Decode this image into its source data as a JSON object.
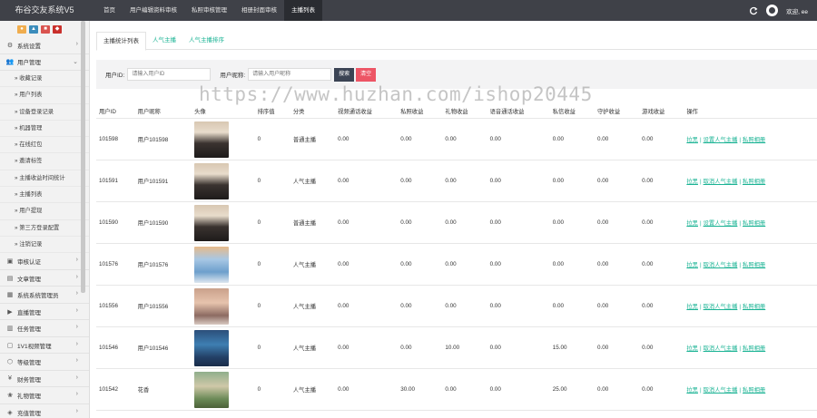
{
  "brand": "布谷交友系统V5",
  "topnav": [
    "首页",
    "用户编辑资料审核",
    "私照审核管理",
    "相册封面审核",
    "主播列表"
  ],
  "topnav_active": 4,
  "welcome": "欢迎, ee",
  "sidebar": {
    "quick_buttons": [
      "●",
      "▲",
      "■",
      "◆"
    ],
    "items": [
      {
        "type": "menu",
        "icon": "⚙",
        "label": "系统设置"
      },
      {
        "type": "menu",
        "icon": "👥",
        "label": "用户管理",
        "expanded": true
      },
      {
        "type": "sub",
        "label": "» 收藏记录"
      },
      {
        "type": "sub",
        "label": "» 用户列表"
      },
      {
        "type": "sub",
        "label": "» 设备登录记录"
      },
      {
        "type": "sub",
        "label": "» 机器管理"
      },
      {
        "type": "sub",
        "label": "» 在线红包"
      },
      {
        "type": "sub",
        "label": "» 邀请标签"
      },
      {
        "type": "sub",
        "label": "» 主播收益时间统计"
      },
      {
        "type": "sub",
        "label": "» 主播列表"
      },
      {
        "type": "sub",
        "label": "» 用户提现"
      },
      {
        "type": "sub",
        "label": "» 第三方登录配置"
      },
      {
        "type": "sub",
        "label": "» 注销记录"
      },
      {
        "type": "menu",
        "icon": "▣",
        "label": "审核认证"
      },
      {
        "type": "menu",
        "icon": "▤",
        "label": "文章管理"
      },
      {
        "type": "menu",
        "icon": "▦",
        "label": "系统系统管理员"
      },
      {
        "type": "menu",
        "icon": "▶",
        "label": "直播管理"
      },
      {
        "type": "menu",
        "icon": "▥",
        "label": "任务管理"
      },
      {
        "type": "menu",
        "icon": "▢",
        "label": "1V1视频管理"
      },
      {
        "type": "menu",
        "icon": "⬡",
        "label": "等级管理"
      },
      {
        "type": "menu",
        "icon": "¥",
        "label": "财务管理"
      },
      {
        "type": "menu",
        "icon": "❀",
        "label": "礼物管理"
      },
      {
        "type": "menu",
        "icon": "◈",
        "label": "充值管理"
      }
    ]
  },
  "tabs": [
    "主播统计列表",
    "人气主播",
    "人气主播排序"
  ],
  "search": {
    "uid_label": "用户ID:",
    "uid_placeholder": "请输入用户ID",
    "nick_label": "用户昵称:",
    "nick_placeholder": "请输入用户昵称",
    "search_btn": "搜索",
    "clear_btn": "清空"
  },
  "columns": [
    "用户ID",
    "用户昵称",
    "头像",
    "排序值",
    "分类",
    "视频通话收益",
    "私照收益",
    "礼物收益",
    "语音通话收益",
    "私信收益",
    "守护收益",
    "游戏收益",
    "操作"
  ],
  "rows": [
    {
      "uid": "101598",
      "nick": "用户101598",
      "photo": "ph-a",
      "sort": "0",
      "cat": "普通主播",
      "v": [
        "0.00",
        "0.00",
        "0.00",
        "0.00",
        "0.00",
        "0.00",
        "0.00"
      ],
      "ops": [
        "拉黑",
        "设置人气主播",
        "私照相册"
      ]
    },
    {
      "uid": "101591",
      "nick": "用户101591",
      "photo": "ph-a",
      "sort": "0",
      "cat": "人气主播",
      "v": [
        "0.00",
        "0.00",
        "0.00",
        "0.00",
        "0.00",
        "0.00",
        "0.00"
      ],
      "ops": [
        "拉黑",
        "取消人气主播",
        "私照相册"
      ]
    },
    {
      "uid": "101590",
      "nick": "用户101590",
      "photo": "ph-a",
      "sort": "0",
      "cat": "普通主播",
      "v": [
        "0.00",
        "0.00",
        "0.00",
        "0.00",
        "0.00",
        "0.00",
        "0.00"
      ],
      "ops": [
        "拉黑",
        "设置人气主播",
        "私照相册"
      ]
    },
    {
      "uid": "101576",
      "nick": "用户101576",
      "photo": "ph-b",
      "sort": "0",
      "cat": "人气主播",
      "v": [
        "0.00",
        "0.00",
        "0.00",
        "0.00",
        "0.00",
        "0.00",
        "0.00"
      ],
      "ops": [
        "拉黑",
        "取消人气主播",
        "私照相册"
      ]
    },
    {
      "uid": "101556",
      "nick": "用户101556",
      "photo": "ph-c",
      "sort": "0",
      "cat": "人气主播",
      "v": [
        "0.00",
        "0.00",
        "0.00",
        "0.00",
        "0.00",
        "0.00",
        "0.00"
      ],
      "ops": [
        "拉黑",
        "取消人气主播",
        "私照相册"
      ]
    },
    {
      "uid": "101546",
      "nick": "用户101546",
      "photo": "ph-d",
      "sort": "0",
      "cat": "人气主播",
      "v": [
        "0.00",
        "0.00",
        "10.00",
        "0.00",
        "15.00",
        "0.00",
        "0.00"
      ],
      "ops": [
        "拉黑",
        "取消人气主播",
        "私照相册"
      ]
    },
    {
      "uid": "101542",
      "nick": "花香",
      "photo": "ph-e",
      "sort": "0",
      "cat": "人气主播",
      "v": [
        "0.00",
        "30.00",
        "0.00",
        "0.00",
        "25.00",
        "0.00",
        "0.00"
      ],
      "ops": [
        "拉黑",
        "取消人气主播",
        "私照相册"
      ]
    }
  ],
  "watermark": "https://www.huzhan.com/ishop20445"
}
